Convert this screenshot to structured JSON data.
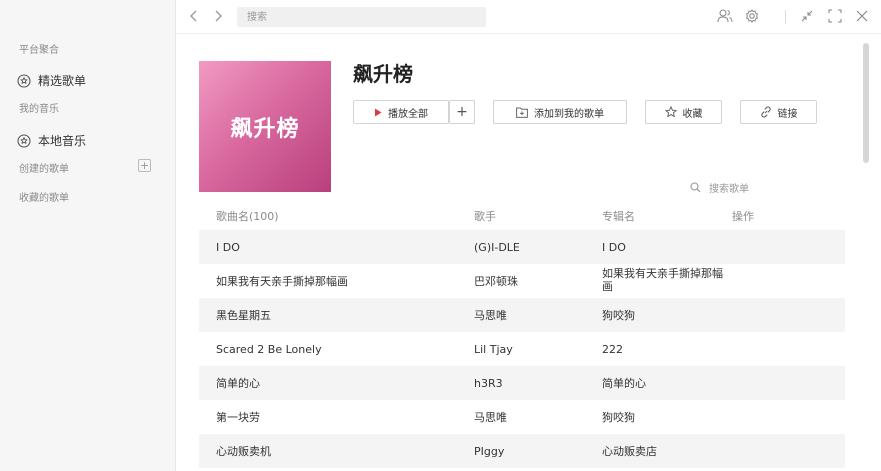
{
  "sidebar": {
    "section_platform": "平台聚合",
    "featured_playlist": "精选歌单",
    "section_my_music": "我的音乐",
    "local_music": "本地音乐",
    "created_playlists": "创建的歌单",
    "collected_playlists": "收藏的歌单",
    "add_symbol": "+"
  },
  "topbar": {
    "search_placeholder": "搜索"
  },
  "playlist": {
    "cover_text": "飙升榜",
    "title": "飙升榜",
    "play_all": "播放全部",
    "add_symbol": "+",
    "add_to_my": "添加到我的歌单",
    "favorite": "收藏",
    "link": "链接",
    "search_placeholder": "搜索歌单"
  },
  "table": {
    "headers": {
      "song": "歌曲名(100)",
      "artist": "歌手",
      "album": "专辑名",
      "actions": "操作"
    },
    "rows": [
      {
        "song": "I DO",
        "artist": "(G)I-DLE",
        "album": "I DO"
      },
      {
        "song": "如果我有天亲手撕掉那幅画",
        "artist": "巴邓顿珠",
        "album": "如果我有天亲手撕掉那幅画"
      },
      {
        "song": "黑色星期五",
        "artist": "马思唯",
        "album": "狗咬狗"
      },
      {
        "song": "Scared 2 Be Lonely",
        "artist": "Lil Tjay",
        "album": "222"
      },
      {
        "song": "简单的心",
        "artist": "h3R3",
        "album": "简单的心"
      },
      {
        "song": "第一块劳",
        "artist": "马思唯",
        "album": "狗咬狗"
      },
      {
        "song": "心动贩卖机",
        "artist": "PIggy",
        "album": "心动贩卖店"
      }
    ]
  },
  "colors": {
    "accent_red": "#e03a3a",
    "cover_gradient_start": "#f29ac3",
    "cover_gradient_end": "#b93f7c"
  },
  "icons": [
    "chevron-left-icon",
    "chevron-right-icon",
    "user-icon",
    "gear-icon",
    "minimize-icon",
    "fullscreen-icon",
    "close-icon",
    "star-icon",
    "play-icon",
    "add-folder-icon",
    "link-icon",
    "search-icon"
  ]
}
